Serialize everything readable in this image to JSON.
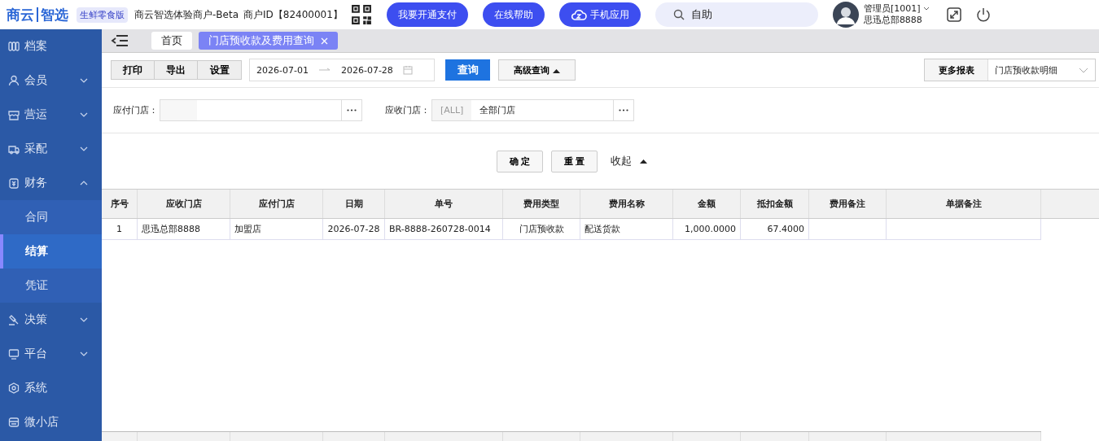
{
  "header": {
    "logo_left": "商云",
    "logo_right": "智选",
    "edition_badge": "生鲜零食版",
    "merchant_name": "商云智选体验商户-Beta",
    "merchant_id": "商户ID【82400001】",
    "buttons": [
      {
        "label": "我要开通支付",
        "kind": "plain"
      },
      {
        "label": "在线帮助",
        "kind": "plain"
      },
      {
        "label": "手机应用",
        "kind": "cloud"
      }
    ],
    "search": {
      "value": "自助"
    },
    "user": {
      "role": "管理员[1001]",
      "store": "思迅总部8888"
    }
  },
  "sidebar": {
    "items": [
      {
        "label": "档案",
        "kind": "link"
      },
      {
        "label": "会员",
        "kind": "group",
        "expanded": false
      },
      {
        "label": "营运",
        "kind": "group",
        "expanded": false
      },
      {
        "label": "采配",
        "kind": "group",
        "expanded": false
      },
      {
        "label": "财务",
        "kind": "group",
        "expanded": true,
        "children": [
          {
            "label": "合同",
            "selected": false
          },
          {
            "label": "结算",
            "selected": true
          },
          {
            "label": "凭证",
            "selected": false
          }
        ]
      },
      {
        "label": "决策",
        "kind": "group",
        "expanded": false
      },
      {
        "label": "平台",
        "kind": "group",
        "expanded": false
      },
      {
        "label": "系统",
        "kind": "link"
      },
      {
        "label": "微小店",
        "kind": "link"
      }
    ]
  },
  "tabs": [
    {
      "label": "首页",
      "selected": false,
      "closable": false
    },
    {
      "label": "门店预收款及费用查询",
      "selected": true,
      "closable": true
    }
  ],
  "toolbar": {
    "buttons": [
      "打印",
      "导出",
      "设置"
    ],
    "date_from": "2026-07-01",
    "date_to": "2026-07-28",
    "query_button": "查询",
    "advanced_button": "高级查询",
    "more_reports_button": "更多报表",
    "report_select": "门店预收款明细"
  },
  "filters": [
    {
      "label": "应付门店："
    },
    {
      "label": "应收门店：",
      "tag": "[ALL]",
      "value": "全部门店"
    }
  ],
  "filter_actions": {
    "confirm": "确 定",
    "reset": "重 置",
    "collapse": "收起"
  },
  "table": {
    "columns": [
      "序号",
      "应收门店",
      "应付门店",
      "日期",
      "单号",
      "费用类型",
      "费用名称",
      "金额",
      "抵扣金额",
      "费用备注",
      "单据备注"
    ],
    "rows": [
      [
        "1",
        "思迅总部8888",
        "加盟店",
        "2026-07-28",
        "BR-8888-260728-0014",
        "门店预收款",
        "配送货款",
        "1,000.0000",
        "67.4000",
        "",
        ""
      ]
    ]
  }
}
